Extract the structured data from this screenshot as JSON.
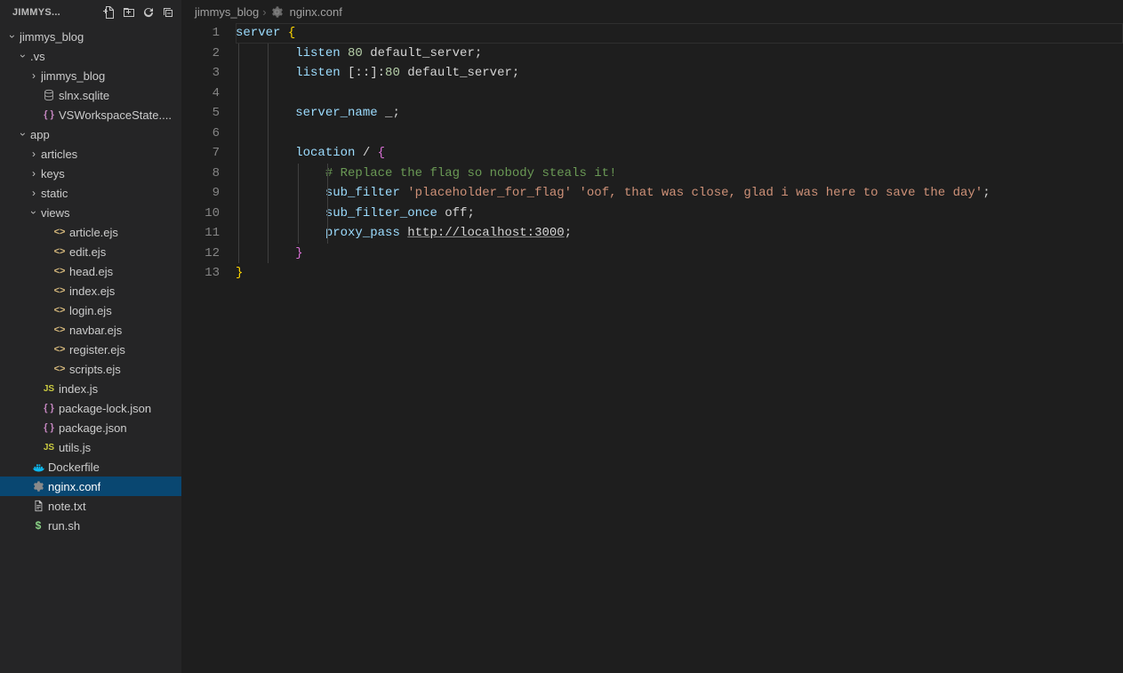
{
  "explorer": {
    "title": "JIMMYS...",
    "actions": [
      "new-file",
      "new-folder",
      "refresh",
      "collapse-all"
    ],
    "tree": [
      {
        "type": "folder",
        "name": "jimmys_blog",
        "expanded": true,
        "depth": 0,
        "icon": "chevron-down"
      },
      {
        "type": "folder",
        "name": ".vs",
        "expanded": true,
        "depth": 1,
        "icon": "chevron-down"
      },
      {
        "type": "folder",
        "name": "jimmys_blog",
        "expanded": false,
        "depth": 2,
        "icon": "chevron-right"
      },
      {
        "type": "file",
        "name": "slnx.sqlite",
        "depth": 2,
        "icon": "db"
      },
      {
        "type": "file",
        "name": "VSWorkspaceState....",
        "depth": 2,
        "icon": "json"
      },
      {
        "type": "folder",
        "name": "app",
        "expanded": true,
        "depth": 1,
        "icon": "chevron-down"
      },
      {
        "type": "folder",
        "name": "articles",
        "expanded": false,
        "depth": 2,
        "icon": "chevron-right"
      },
      {
        "type": "folder",
        "name": "keys",
        "expanded": false,
        "depth": 2,
        "icon": "chevron-right"
      },
      {
        "type": "folder",
        "name": "static",
        "expanded": false,
        "depth": 2,
        "icon": "chevron-right"
      },
      {
        "type": "folder",
        "name": "views",
        "expanded": true,
        "depth": 2,
        "icon": "chevron-down"
      },
      {
        "type": "file",
        "name": "article.ejs",
        "depth": 3,
        "icon": "ejs"
      },
      {
        "type": "file",
        "name": "edit.ejs",
        "depth": 3,
        "icon": "ejs"
      },
      {
        "type": "file",
        "name": "head.ejs",
        "depth": 3,
        "icon": "ejs"
      },
      {
        "type": "file",
        "name": "index.ejs",
        "depth": 3,
        "icon": "ejs"
      },
      {
        "type": "file",
        "name": "login.ejs",
        "depth": 3,
        "icon": "ejs"
      },
      {
        "type": "file",
        "name": "navbar.ejs",
        "depth": 3,
        "icon": "ejs"
      },
      {
        "type": "file",
        "name": "register.ejs",
        "depth": 3,
        "icon": "ejs"
      },
      {
        "type": "file",
        "name": "scripts.ejs",
        "depth": 3,
        "icon": "ejs"
      },
      {
        "type": "file",
        "name": "index.js",
        "depth": 2,
        "icon": "js"
      },
      {
        "type": "file",
        "name": "package-lock.json",
        "depth": 2,
        "icon": "json"
      },
      {
        "type": "file",
        "name": "package.json",
        "depth": 2,
        "icon": "json"
      },
      {
        "type": "file",
        "name": "utils.js",
        "depth": 2,
        "icon": "js"
      },
      {
        "type": "file",
        "name": "Dockerfile",
        "depth": 1,
        "icon": "docker"
      },
      {
        "type": "file",
        "name": "nginx.conf",
        "depth": 1,
        "icon": "gear",
        "active": true
      },
      {
        "type": "file",
        "name": "note.txt",
        "depth": 1,
        "icon": "txt"
      },
      {
        "type": "file",
        "name": "run.sh",
        "depth": 1,
        "icon": "dollar"
      }
    ]
  },
  "breadcrumbs": [
    {
      "label": "jimmys_blog",
      "icon": null
    },
    {
      "label": "nginx.conf",
      "icon": "gear"
    }
  ],
  "editor": {
    "filename": "nginx.conf",
    "line_count": 13,
    "tokens": [
      [
        [
          "server ",
          "kw"
        ],
        [
          "{",
          "brace"
        ]
      ],
      [
        [
          "        ",
          ""
        ],
        [
          "listen ",
          "kw"
        ],
        [
          "80",
          "num"
        ],
        [
          " default_server",
          "plain"
        ],
        [
          ";",
          "punct"
        ]
      ],
      [
        [
          "        ",
          ""
        ],
        [
          "listen ",
          "kw"
        ],
        [
          "[::]:",
          "plain"
        ],
        [
          "80",
          "num"
        ],
        [
          " default_server",
          "plain"
        ],
        [
          ";",
          "punct"
        ]
      ],
      [],
      [
        [
          "        ",
          ""
        ],
        [
          "server_name ",
          "kw"
        ],
        [
          "_",
          "plain"
        ],
        [
          ";",
          "punct"
        ]
      ],
      [],
      [
        [
          "        ",
          ""
        ],
        [
          "location ",
          "kw"
        ],
        [
          "/ ",
          "plain"
        ],
        [
          "{",
          "brace2"
        ]
      ],
      [
        [
          "            ",
          ""
        ],
        [
          "# Replace the flag so nobody steals it!",
          "comment"
        ]
      ],
      [
        [
          "            ",
          ""
        ],
        [
          "sub_filter ",
          "kw"
        ],
        [
          "'placeholder_for_flag'",
          "str"
        ],
        [
          " ",
          "plain"
        ],
        [
          "'oof, that was close, glad i was here to save the day'",
          "str"
        ],
        [
          ";",
          "punct"
        ]
      ],
      [
        [
          "            ",
          ""
        ],
        [
          "sub_filter_once ",
          "kw"
        ],
        [
          "off",
          "plain"
        ],
        [
          ";",
          "punct"
        ]
      ],
      [
        [
          "            ",
          ""
        ],
        [
          "proxy_pass ",
          "kw"
        ],
        [
          "http://localhost:3000",
          "url"
        ],
        [
          ";",
          "punct"
        ]
      ],
      [
        [
          "        ",
          ""
        ],
        [
          "}",
          "brace2"
        ]
      ],
      [
        [
          "}",
          "brace"
        ]
      ]
    ]
  }
}
